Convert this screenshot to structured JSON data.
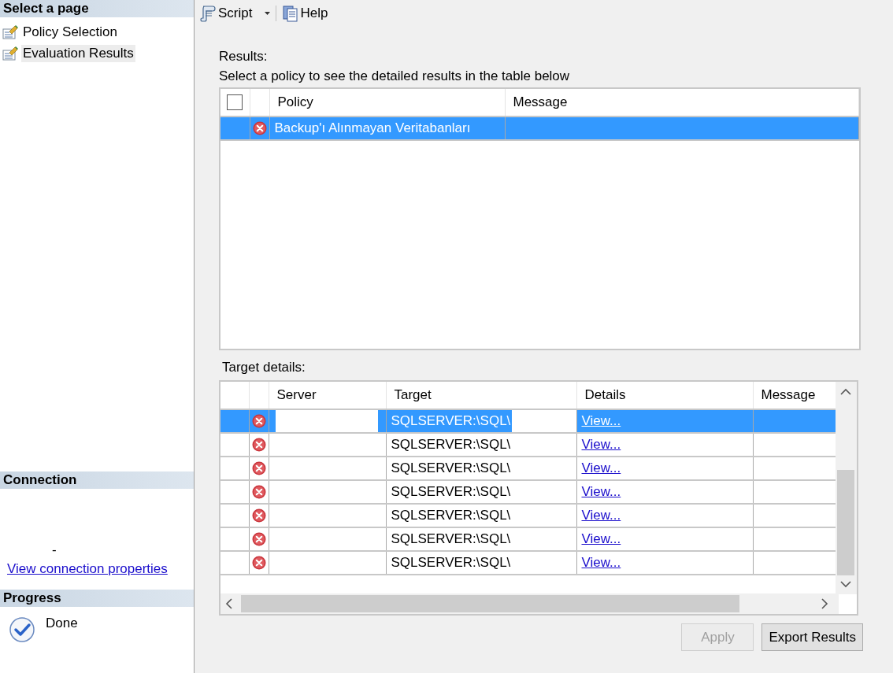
{
  "sidebar": {
    "select_page": {
      "title": "Select a page",
      "items": [
        {
          "label": "Policy Selection",
          "selected": false
        },
        {
          "label": "Evaluation Results",
          "selected": true
        }
      ]
    },
    "connection": {
      "title": "Connection",
      "text": "-",
      "link": "View connection properties"
    },
    "progress": {
      "title": "Progress",
      "status": "Done"
    }
  },
  "toolbar": [
    {
      "label": "Script",
      "kind": "dropdown"
    },
    {
      "label": "Help",
      "kind": "help"
    }
  ],
  "results": {
    "label": "Results:",
    "hint": "Select a policy to see the detailed results in the table below",
    "header_checked": false,
    "columns": [
      "Policy",
      "Message"
    ],
    "rows": [
      {
        "policy": "Backup'ı Alınmayan Veritabanları",
        "failed": true,
        "selected": true
      }
    ]
  },
  "target_details": {
    "label": "Target details:",
    "columns": [
      "Server",
      "Target",
      "Details",
      "Message"
    ],
    "rows": [
      {
        "failed": true,
        "target": "SQLSERVER:\\SQL\\",
        "details": "View...",
        "selected": true
      },
      {
        "failed": true,
        "target": "SQLSERVER:\\SQL\\",
        "details": "View...",
        "selected": false
      },
      {
        "failed": true,
        "target": "SQLSERVER:\\SQL\\",
        "details": "View...",
        "selected": false
      },
      {
        "failed": true,
        "target": "SQLSERVER:\\SQL\\",
        "details": "View...",
        "selected": false
      },
      {
        "failed": true,
        "target": "SQLSERVER:\\SQL\\",
        "details": "View...",
        "selected": false
      },
      {
        "failed": true,
        "target": "SQLSERVER:\\SQL\\",
        "details": "View...",
        "selected": false
      },
      {
        "failed": true,
        "target": "SQLSERVER:\\SQL\\",
        "details": "View...",
        "selected": false
      }
    ]
  },
  "buttons": [
    {
      "label": "Apply",
      "disabled": true
    },
    {
      "label": "Export Results",
      "disabled": false
    }
  ]
}
